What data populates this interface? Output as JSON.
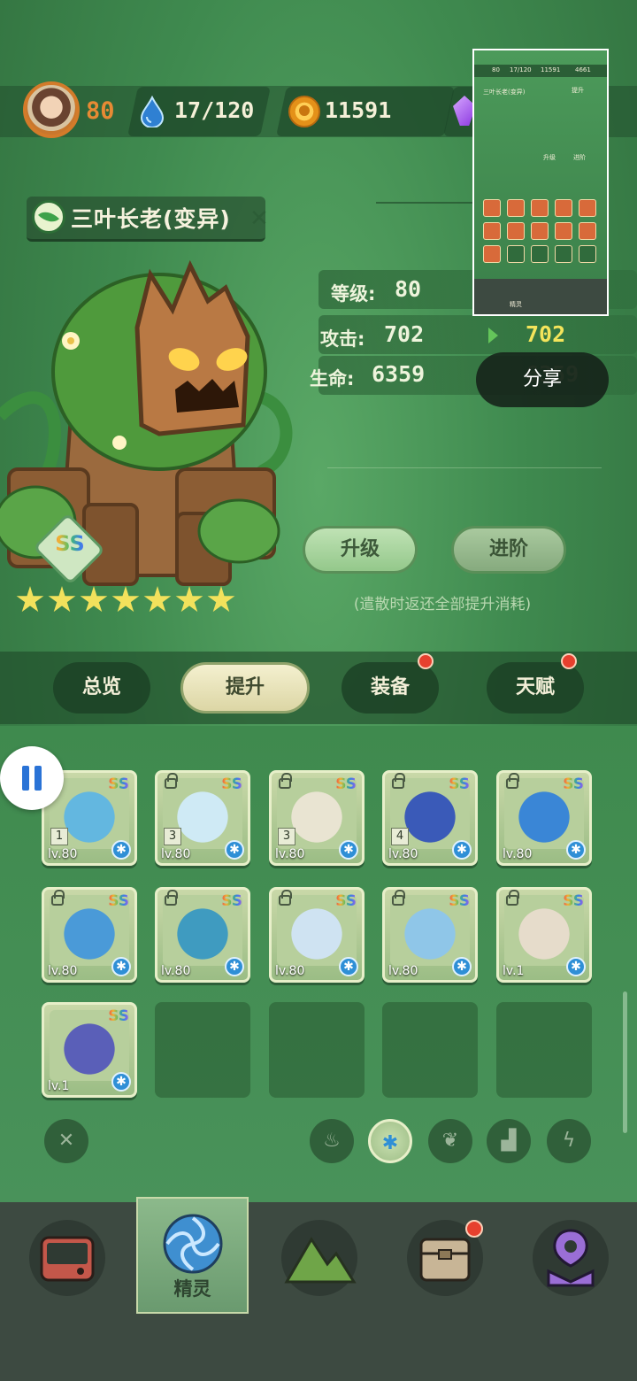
{
  "header": {
    "player_level": "80",
    "stamina": "17/120",
    "coins": "11591"
  },
  "creature": {
    "name": "三叶长老(变异)",
    "rarity": "SS",
    "stars": 7
  },
  "stats": {
    "level_label": "等级:",
    "level_value": "80",
    "attack_label": "攻击:",
    "attack_value": "702",
    "attack_next": "702",
    "hp_label": "生命:",
    "hp_value": "6359",
    "hp_next": "6359"
  },
  "share_label": "分享",
  "actions": {
    "upgrade": "升级",
    "advance": "进阶",
    "hint": "(遣散时返还全部提升消耗)"
  },
  "tabs": [
    {
      "label": "总览",
      "active": false,
      "badge": false
    },
    {
      "label": "提升",
      "active": true,
      "badge": false
    },
    {
      "label": "装备",
      "active": false,
      "badge": true
    },
    {
      "label": "天赋",
      "active": false,
      "badge": true
    }
  ],
  "grid": {
    "cards": [
      {
        "level": "lv.80",
        "rarity": "SS",
        "locked": false,
        "count": "1",
        "color": "#63b7e0"
      },
      {
        "level": "lv.80",
        "rarity": "SS",
        "locked": true,
        "count": "3",
        "color": "#cfeaf5"
      },
      {
        "level": "lv.80",
        "rarity": "SS",
        "locked": true,
        "count": "3",
        "color": "#e9e4d2"
      },
      {
        "level": "lv.80",
        "rarity": "SS",
        "locked": true,
        "count": "4",
        "color": "#3a5ab8"
      },
      {
        "level": "lv.80",
        "rarity": "SS",
        "locked": true,
        "count": "",
        "color": "#3a86d6"
      },
      {
        "level": "lv.80",
        "rarity": "SS",
        "locked": true,
        "count": "",
        "color": "#4a9ad8"
      },
      {
        "level": "lv.80",
        "rarity": "SS",
        "locked": true,
        "count": "",
        "color": "#3f9bc0"
      },
      {
        "level": "lv.80",
        "rarity": "SS",
        "locked": true,
        "count": "",
        "color": "#cfe3f2"
      },
      {
        "level": "lv.80",
        "rarity": "SS",
        "locked": true,
        "count": "",
        "color": "#8fc6e8"
      },
      {
        "level": "lv.1",
        "rarity": "SS",
        "locked": true,
        "count": "",
        "color": "#e6dccb"
      },
      {
        "level": "lv.1",
        "rarity": "SS",
        "locked": false,
        "count": "",
        "color": "#5a5fb8"
      }
    ],
    "empty_slots": 4
  },
  "filters": [
    "close",
    "fire",
    "ice",
    "leaf",
    "earth",
    "lightning"
  ],
  "active_filter": "ice",
  "bottom_nav": [
    {
      "label": "",
      "icon": "device-icon",
      "badge": false
    },
    {
      "label": "精灵",
      "icon": "spirit-swirl-icon",
      "badge": false,
      "active": true
    },
    {
      "label": "",
      "icon": "mountain-icon",
      "badge": false
    },
    {
      "label": "",
      "icon": "bag-icon",
      "badge": true
    },
    {
      "label": "",
      "icon": "map-pin-icon",
      "badge": false
    }
  ],
  "preview": {
    "level": "80",
    "stamina": "17/120",
    "coins": "11591",
    "gems": "4661",
    "title": "三叶长老(变异)",
    "tab": "提升",
    "upgrade": "升级",
    "advance": "进阶",
    "nav_label": "精灵"
  }
}
